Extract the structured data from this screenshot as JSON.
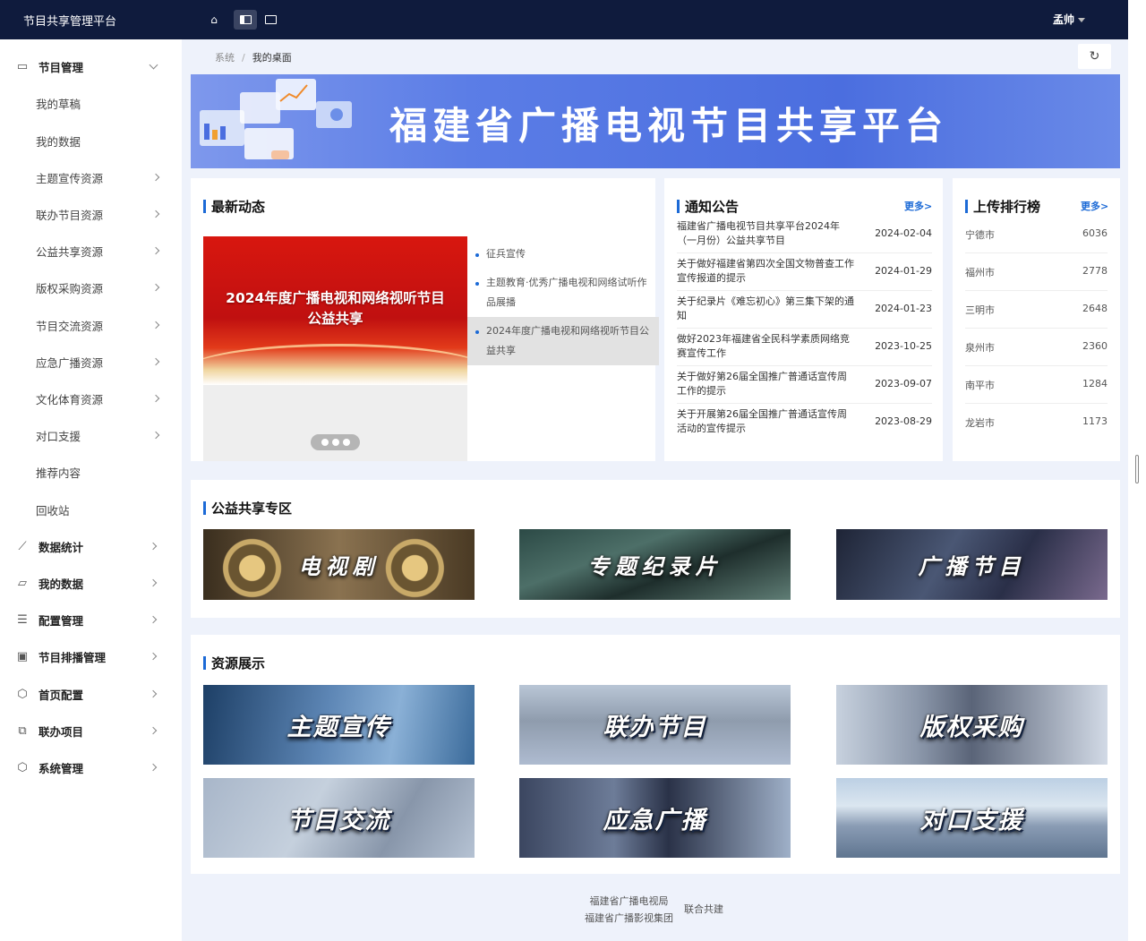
{
  "topbar": {
    "brand": "节目共享管理平台",
    "user": "孟帅",
    "icons": [
      "home-icon",
      "layout-split-icon",
      "layout-full-icon"
    ]
  },
  "sidebar": {
    "group1": {
      "label": "节目管理",
      "icon": "program-icon",
      "expanded": true
    },
    "sub_items": [
      "我的草稿",
      "我的数据",
      "主题宣传资源",
      "联办节目资源",
      "公益共享资源",
      "版权采购资源",
      "节目交流资源",
      "应急广播资源",
      "文化体育资源",
      "对口支援",
      "推荐内容",
      "回收站"
    ],
    "groups": [
      {
        "label": "数据统计",
        "icon": "chart-icon"
      },
      {
        "label": "我的数据",
        "icon": "folder-icon"
      },
      {
        "label": "配置管理",
        "icon": "list-icon"
      },
      {
        "label": "节目排播管理",
        "icon": "calendar-icon"
      },
      {
        "label": "首页配置",
        "icon": "settings-icon"
      },
      {
        "label": "联办项目",
        "icon": "copy-icon"
      },
      {
        "label": "系统管理",
        "icon": "gear-icon"
      }
    ]
  },
  "breadcrumb": {
    "root": "系统",
    "sep": "/",
    "current": "我的桌面"
  },
  "banner": {
    "title": "福建省广播电视节目共享平台"
  },
  "news": {
    "title": "最新动态",
    "image_text_line1": "2024年度广播电视和网络视听节目",
    "image_text_line2": "公益共享",
    "items": [
      "征兵宣传",
      "主题教育·优秀广播电视和网络试听作品展播",
      "2024年度广播电视和网络视听节目公益共享"
    ],
    "active_index": 2
  },
  "notice": {
    "title": "通知公告",
    "more": "更多>",
    "rows": [
      {
        "text": "福建省广播电视节目共享平台2024年（一月份）公益共享节目",
        "date": "2024-02-04"
      },
      {
        "text": "关于做好福建省第四次全国文物普查工作宣传报道的提示",
        "date": "2024-01-29"
      },
      {
        "text": "关于纪录片《难忘初心》第三集下架的通知",
        "date": "2024-01-23"
      },
      {
        "text": "做好2023年福建省全民科学素质网络竞赛宣传工作",
        "date": "2023-10-25"
      },
      {
        "text": "关于做好第26届全国推广普通话宣传周工作的提示",
        "date": "2023-09-07"
      },
      {
        "text": "关于开展第26届全国推广普通话宣传周活动的宣传提示",
        "date": "2023-08-29"
      }
    ]
  },
  "ranking": {
    "title": "上传排行榜",
    "more": "更多>",
    "rows": [
      {
        "city": "宁德市",
        "value": "6036"
      },
      {
        "city": "福州市",
        "value": "2778"
      },
      {
        "city": "三明市",
        "value": "2648"
      },
      {
        "city": "泉州市",
        "value": "2360"
      },
      {
        "city": "南平市",
        "value": "1284"
      },
      {
        "city": "龙岩市",
        "value": "1173"
      }
    ]
  },
  "public_share": {
    "title": "公益共享专区",
    "tiles": [
      "电视剧",
      "专题纪录片",
      "广播节目"
    ]
  },
  "resources": {
    "title": "资源展示",
    "tiles": [
      "主题宣传",
      "联办节目",
      "版权采购",
      "节目交流",
      "应急广播",
      "对口支援"
    ]
  },
  "footer": {
    "line1": "福建省广播电视局",
    "line2": "福建省广播影视集团",
    "suffix": "联合共建"
  }
}
